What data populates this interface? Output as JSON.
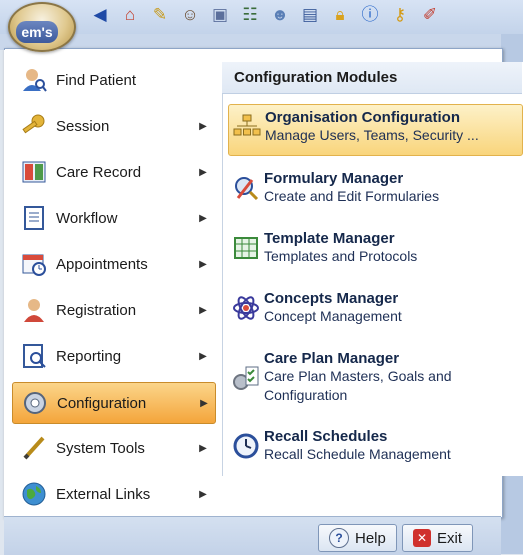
{
  "app": {
    "orb_label": "em's"
  },
  "quick_access": {
    "icons": [
      "back-icon",
      "home-icon",
      "edit-icon",
      "users-icon",
      "folder-icon",
      "list-icon",
      "patients-icon",
      "document-icon",
      "lock-icon",
      "info-icon",
      "key-icon",
      "pencil-icon"
    ]
  },
  "left_menu": {
    "items": [
      {
        "label": "Find Patient",
        "icon": "find-patient-icon",
        "has_submenu": false,
        "active": false
      },
      {
        "label": "Session",
        "icon": "key-icon",
        "has_submenu": true,
        "active": false
      },
      {
        "label": "Care Record",
        "icon": "care-record-icon",
        "has_submenu": true,
        "active": false
      },
      {
        "label": "Workflow",
        "icon": "workflow-icon",
        "has_submenu": true,
        "active": false
      },
      {
        "label": "Appointments",
        "icon": "appointments-icon",
        "has_submenu": true,
        "active": false
      },
      {
        "label": "Registration",
        "icon": "registration-icon",
        "has_submenu": true,
        "active": false
      },
      {
        "label": "Reporting",
        "icon": "reporting-icon",
        "has_submenu": true,
        "active": false
      },
      {
        "label": "Configuration",
        "icon": "configuration-icon",
        "has_submenu": true,
        "active": true
      },
      {
        "label": "System Tools",
        "icon": "system-tools-icon",
        "has_submenu": true,
        "active": false
      },
      {
        "label": "External Links",
        "icon": "external-links-icon",
        "has_submenu": true,
        "active": false
      }
    ]
  },
  "submenu": {
    "header": "Configuration Modules",
    "items": [
      {
        "title": "Organisation Configuration",
        "desc": "Manage Users, Teams, Security ...",
        "icon": "organisation-icon",
        "active": true
      },
      {
        "title": "Formulary Manager",
        "desc": "Create and Edit Formularies",
        "icon": "formulary-icon",
        "active": false
      },
      {
        "title": "Template Manager",
        "desc": "Templates and Protocols",
        "icon": "template-icon",
        "active": false
      },
      {
        "title": "Concepts Manager",
        "desc": "Concept Management",
        "icon": "concepts-icon",
        "active": false
      },
      {
        "title": "Care Plan Manager",
        "desc": "Care Plan Masters, Goals and Configuration",
        "icon": "care-plan-icon",
        "active": false
      },
      {
        "title": "Recall Schedules",
        "desc": "Recall Schedule Management",
        "icon": "recall-icon",
        "active": false
      }
    ]
  },
  "footer": {
    "help_label": "Help",
    "exit_label": "Exit"
  },
  "colors": {
    "accent_orange": "#f4a53b",
    "header_blue": "#dfe8f4",
    "exit_red": "#d0312d"
  }
}
